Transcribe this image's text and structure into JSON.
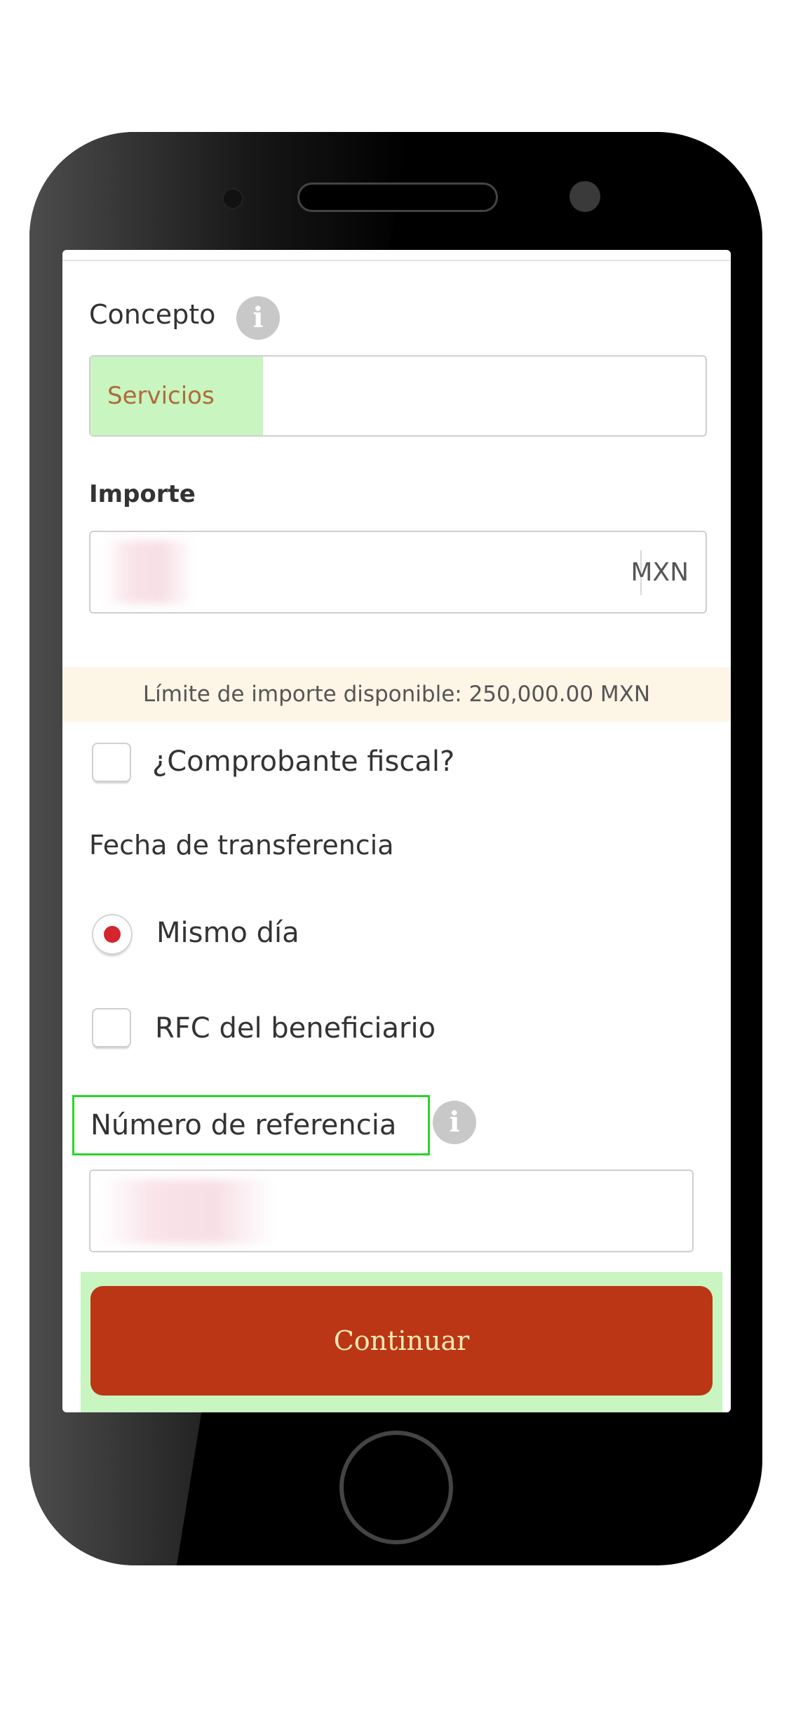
{
  "form": {
    "concepto_label": "Concepto",
    "concepto_value": "Servicios",
    "importe_label": "Importe",
    "importe_currency": "MXN",
    "limit_text": "Límite de importe disponible:  250,000.00 MXN",
    "comprobante_label": "¿Comprobante fiscal?",
    "fecha_label": "Fecha de transferencia",
    "mismo_dia_label": "Mismo día",
    "rfc_label": "RFC del beneficiario",
    "referencia_label": "Número de referencia",
    "continue_label": "Continuar"
  },
  "icons": {
    "info": "info-icon",
    "info_glyph": "i"
  },
  "colors": {
    "accent_button": "#bb3614",
    "radio_selected": "#d3262f",
    "highlight_green": "#2ad42a",
    "limit_background": "#fdf5e6"
  }
}
